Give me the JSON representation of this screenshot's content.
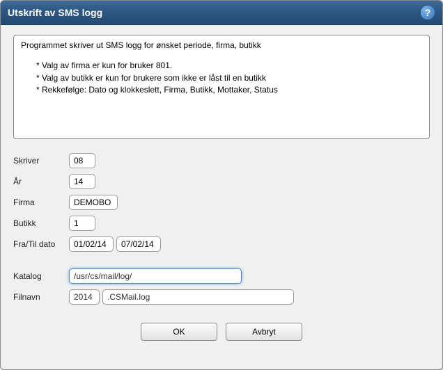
{
  "title": "Utskrift av SMS logg",
  "help_icon": "?",
  "description": {
    "intro": "Programmet skriver ut SMS logg for ønsket periode, firma, butikk",
    "b1": "* Valg av firma er kun for bruker 801.",
    "b2": "* Valg av butikk er kun for brukere som ikke er låst til en butikk",
    "b3": "* Rekkefølge: Dato og klokkeslett, Firma, Butikk, Mottaker, Status"
  },
  "labels": {
    "skriver": "Skriver",
    "aar": "År",
    "firma": "Firma",
    "butikk": "Butikk",
    "fratil": "Fra/Til dato",
    "katalog": "Katalog",
    "filnavn": "Filnavn"
  },
  "values": {
    "skriver": "08",
    "aar": "14",
    "firma": "DEMOBO",
    "butikk": "1",
    "fra": "01/02/14",
    "til": "07/02/14",
    "katalog": "/usr/cs/mail/log/",
    "filyear": "2014",
    "filnavn": ".CSMail.log"
  },
  "buttons": {
    "ok": "OK",
    "cancel": "Avbryt"
  }
}
